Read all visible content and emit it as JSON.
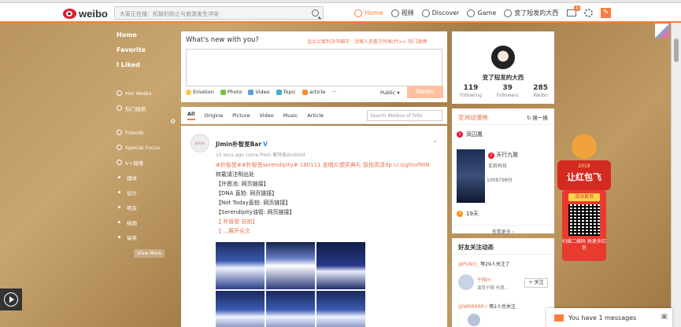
{
  "topbar": {
    "logo_text": "weibo",
    "search_placeholder": "大家正在搜：机智的防止与旅游发生冲突",
    "nav": [
      {
        "label": "Home",
        "icon": "home-icon",
        "active": true
      },
      {
        "label": "视频",
        "icon": "video-icon"
      },
      {
        "label": "Discover",
        "icon": "compass-icon"
      },
      {
        "label": "Game",
        "icon": "game-icon"
      },
      {
        "label": "变了短发的大西",
        "icon": "user-icon"
      }
    ],
    "mail_badge": "1"
  },
  "sidebar": {
    "main_items": [
      "Home",
      "Favorite",
      "I Liked"
    ],
    "items": [
      "Hot Weibo",
      "热门视频",
      "Friends",
      "Special Focus",
      "V+微博"
    ],
    "groups": [
      "媒体",
      "设计",
      "明友",
      "绘画",
      "搞笑"
    ],
    "view_more": "View More"
  },
  "publisher": {
    "title": "What's new with you?",
    "hot_topic": "话兰兰案判决书细节：涉案人员看守所病(代>>   热门微博",
    "tools": [
      "Emotion",
      "Photo",
      "Video",
      "Topic",
      "article",
      "···"
    ],
    "privacy": "Public",
    "send_label": "Weibo"
  },
  "feed_tabs": {
    "tabs": [
      "All",
      "Origina",
      "Picture",
      "Video",
      "Music",
      "Article"
    ],
    "search_placeholder": "Search Weibos of follo"
  },
  "post": {
    "author": "Jimin朴智旻Bar",
    "avatar_text": "Jimin",
    "meta": "10 secs ago come from 黄特易Android",
    "lines": [
      "#朴智旻##朴智旻serendipity# 180111 金唱片颁奖典礼 饭拍高清9p cr.sightofMIN",
      "转载请注明出处",
      "【许愿池: 网页链接】",
      "【DNA 直拍: 网页链接】",
      "【Not Today直拍: 网页链接】",
      "【Serendipity油管: 网页链接】",
      "【 朴智旻 自拍】",
      "【 ...展开全文"
    ]
  },
  "profile": {
    "name": "变了短发的大西",
    "stats": [
      {
        "value": "119",
        "label": "Following"
      },
      {
        "value": "39",
        "label": "Followers"
      },
      {
        "value": "285",
        "label": "Weibo"
      }
    ]
  },
  "hot_board": {
    "title": "亚洲动漫榜",
    "switch_label": "换一换",
    "items": [
      {
        "rank": "1",
        "title": "凤囚凰"
      },
      {
        "rank": "2",
        "title": "天行九歌",
        "sub": "玄机科技",
        "count": "1008798分"
      },
      {
        "rank": "3",
        "title": "19天"
      }
    ],
    "more": "查看更多 ›"
  },
  "friends": {
    "title": "好友关注动态",
    "row1_user": "@PUNO_",
    "row1_text": "等29人关注了",
    "friend_name": "于翔m",
    "friend_desc": "演员于翔 代表...",
    "follow_label": "+ 关注",
    "row2_user": "@WRRRRR·r",
    "row2_text": "等2人也关注"
  },
  "promo": {
    "year": "2018",
    "title": "让红包飞",
    "button": "活动首页",
    "caption": "扫描二维码 抢更多红包"
  },
  "message_bar": {
    "text": "You have 1 messages"
  }
}
